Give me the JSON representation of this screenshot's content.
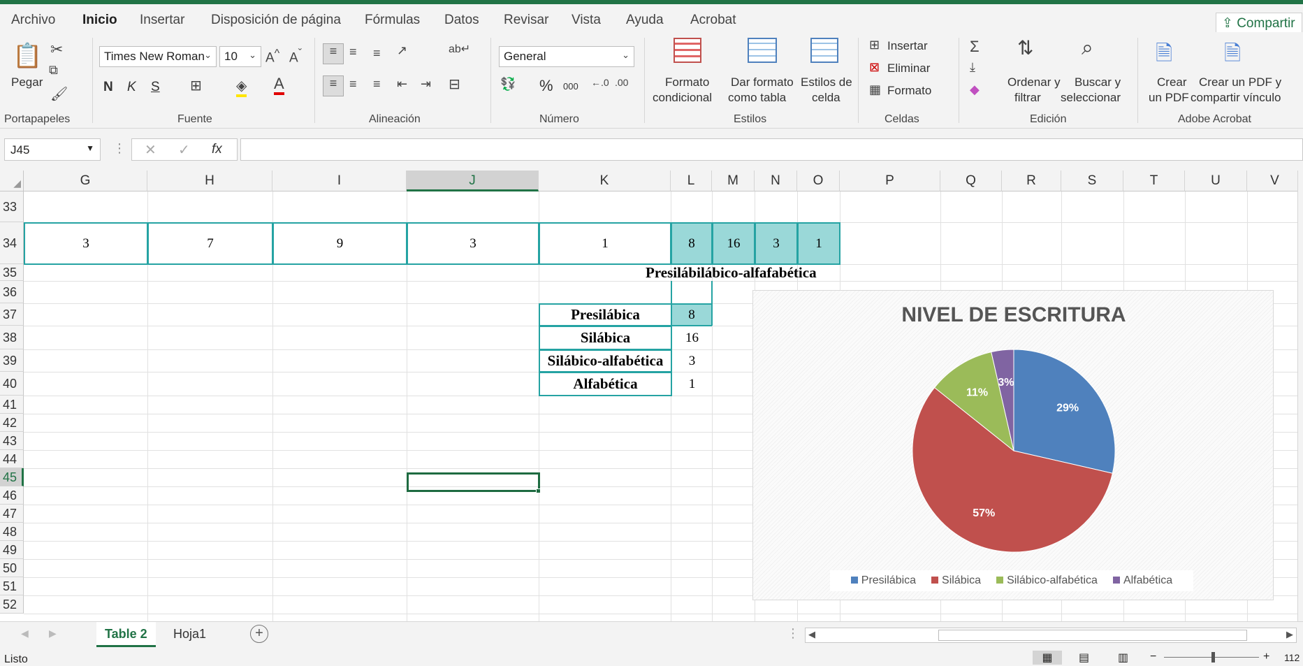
{
  "menu": {
    "tabs": [
      "Archivo",
      "Inicio",
      "Insertar",
      "Disposición de página",
      "Fórmulas",
      "Datos",
      "Revisar",
      "Vista",
      "Ayuda",
      "Acrobat"
    ],
    "active": "Inicio",
    "share_label": "Compartir"
  },
  "ribbon": {
    "clipboard": {
      "paste": "Pegar",
      "group": "Portapapeles"
    },
    "font": {
      "name": "Times New Roman",
      "size": "10",
      "bold": "N",
      "italic": "K",
      "underline": "S",
      "group": "Fuente"
    },
    "alignment": {
      "group": "Alineación"
    },
    "number": {
      "format": "General",
      "percent": "%",
      "thousands": "000",
      "group": "Número"
    },
    "styles": {
      "cond_format": [
        "Formato",
        "condicional"
      ],
      "format_table": [
        "Dar formato",
        "como tabla"
      ],
      "cell_styles": [
        "Estilos de",
        "celda"
      ],
      "group": "Estilos"
    },
    "cells": {
      "insert": "Insertar",
      "delete": "Eliminar",
      "format": "Formato",
      "group": "Celdas"
    },
    "editing": {
      "sort": [
        "Ordenar y",
        "filtrar"
      ],
      "find": [
        "Buscar y",
        "seleccionar"
      ],
      "group": "Edición"
    },
    "acrobat": {
      "create_pdf": [
        "Crear",
        "un PDF"
      ],
      "create_share": [
        "Crear un PDF y",
        "compartir vínculo"
      ],
      "group": "Adobe Acrobat"
    }
  },
  "formula_bar": {
    "name_box": "J45",
    "fx": "fx",
    "formula": ""
  },
  "columns": [
    "G",
    "H",
    "I",
    "J",
    "K",
    "L",
    "M",
    "N",
    "O",
    "P",
    "Q",
    "R",
    "S",
    "T",
    "U",
    "V"
  ],
  "selected_column": "J",
  "rows": [
    "33",
    "34",
    "35",
    "36",
    "37",
    "38",
    "39",
    "40",
    "41",
    "42",
    "43",
    "44",
    "45",
    "46",
    "47",
    "48",
    "49",
    "50",
    "51",
    "52"
  ],
  "selected_row": "45",
  "cells": {
    "row34": [
      "3",
      "7",
      "9",
      "3",
      "1",
      "8",
      "16",
      "3",
      "1"
    ],
    "row35_title": "Presilábilábico-alfafabética",
    "table": [
      {
        "label": "Presilábica",
        "value": "8"
      },
      {
        "label": "Silábica",
        "value": "16"
      },
      {
        "label": "Silábico-alfabética",
        "value": "3"
      },
      {
        "label": "Alfabética",
        "value": "1"
      }
    ]
  },
  "chart_data": {
    "type": "pie",
    "title": "NIVEL DE ESCRITURA",
    "categories": [
      "Presilábica",
      "Silábica",
      "Silábico-alfabética",
      "Alfabética"
    ],
    "values": [
      8,
      16,
      3,
      1
    ],
    "data_labels": [
      "29%",
      "57%",
      "11%",
      "3%"
    ],
    "colors": [
      "#4f81bd",
      "#c0504d",
      "#9bbb59",
      "#8064a2"
    ],
    "legend": "bottom"
  },
  "sheet_tabs": [
    "Table 2",
    "Hoja1"
  ],
  "active_sheet": "Table 2",
  "status": {
    "text": "Listo",
    "zoom": "112"
  }
}
